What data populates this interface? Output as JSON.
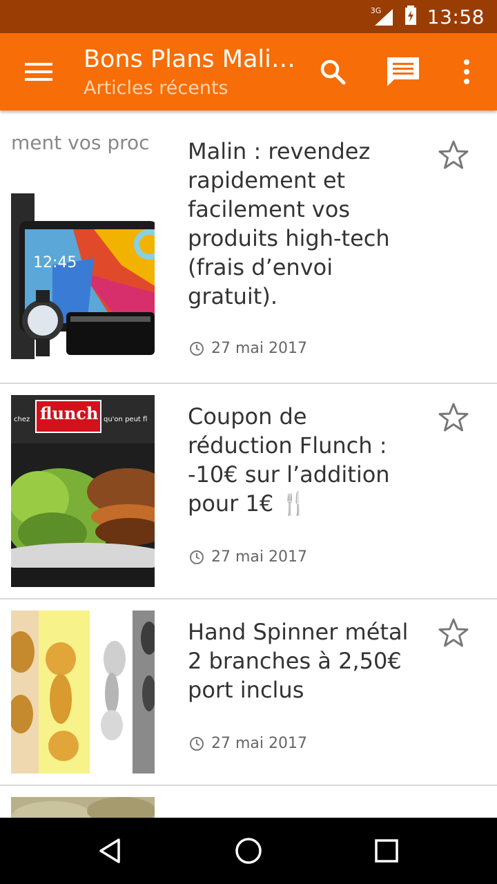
{
  "status_bar": {
    "network": "3G",
    "time": "13:58"
  },
  "app_bar": {
    "title": "Bons Plans Malins",
    "subtitle": "Articles récents",
    "accent_color": "#f76d07",
    "icons": [
      "menu-icon",
      "search-icon",
      "chat-icon",
      "more-vert-icon"
    ]
  },
  "articles": [
    {
      "title": "Malin : revendez rapidement et facilement vos produits high-tech (frais d’envoi gratuit).",
      "date": "27 mai 2017",
      "thumb_text": "ment vos proc",
      "thumb_clock": "12:45"
    },
    {
      "title": "Coupon de réduction Flunch : -10€ sur l’addition pour 1€ 🍴",
      "date": "27 mai 2017",
      "thumb_brand": "flunch",
      "thumb_left": "chez",
      "thumb_right": "qu'on peut fl"
    },
    {
      "title": "Hand Spinner métal 2 branches à 2,50€ port inclus",
      "date": "27 mai 2017"
    }
  ],
  "nav_bar": {
    "icons": [
      "back-icon",
      "home-icon",
      "recents-icon"
    ]
  }
}
